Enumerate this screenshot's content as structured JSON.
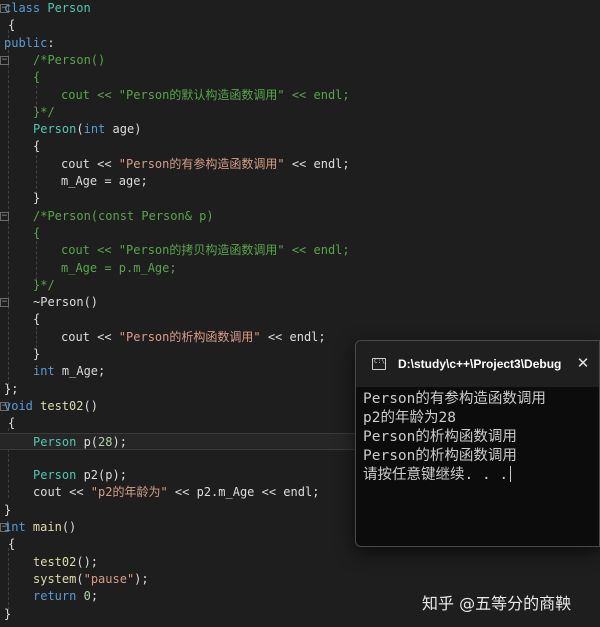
{
  "code": {
    "line1": {
      "k": "class",
      "n": "Person"
    },
    "line2": {
      "b": "{"
    },
    "line3": {
      "k": "public",
      "c": ":"
    },
    "line4": {
      "t": "/*Person()"
    },
    "line5": {
      "t": "{"
    },
    "line6": {
      "t": "cout << \"Person的默认构造函数调用\" << endl;"
    },
    "line7": {
      "t": "}*/"
    },
    "line8": {
      "n": "Person",
      "p1": "(",
      "k": "int",
      "v": " age",
      "p2": ")"
    },
    "line9": {
      "b": "{"
    },
    "line10": {
      "a": "cout << ",
      "s": "\"Person的有参构造函数调用\"",
      "b": " << endl;"
    },
    "line11": {
      "t": "m_Age = age;"
    },
    "line12": {
      "b": "}"
    },
    "line13": {
      "t": "/*Person(const Person& p)"
    },
    "line14": {
      "t": "{"
    },
    "line15": {
      "t": "cout << \"Person的拷贝构造函数调用\" << endl;"
    },
    "line16": {
      "t": "m_Age = p.m_Age;"
    },
    "line17": {
      "t": "}*/"
    },
    "line18": {
      "t": "~Person()"
    },
    "line19": {
      "b": "{"
    },
    "line20": {
      "a": "cout << ",
      "s": "\"Person的析构函数调用\"",
      "b": " << endl;"
    },
    "line21": {
      "b": "}"
    },
    "line22": {
      "k": "int",
      "v": " m_Age;"
    },
    "line23": {
      "b": "};"
    },
    "line24": {
      "k": "void",
      "f": " test02",
      "p": "()"
    },
    "line25": {
      "b": "{"
    },
    "line26": {
      "n": "Person",
      "a": " p(",
      "num": "28",
      "b": ");"
    },
    "line27": {
      "b": ""
    },
    "line28": {
      "n": "Person",
      "a": " p2(p);"
    },
    "line29": {
      "a": "cout << ",
      "s": "\"p2的年龄为\"",
      "b": " << p2.m_Age << endl;"
    },
    "line30": {
      "b": "}"
    },
    "line31": {
      "k": "int",
      "f": " main",
      "p": "()"
    },
    "line32": {
      "b": "{"
    },
    "line33": {
      "f": "test02",
      "a": "();"
    },
    "line34": {
      "f": "system",
      "a": "(",
      "s": "\"pause\"",
      "b": ");"
    },
    "line35": {
      "k": "return",
      "num": " 0",
      "b": ";"
    },
    "line36": {
      "b": "}"
    }
  },
  "console": {
    "title": "D:\\study\\c++\\Project3\\Debug",
    "close_label": "✕",
    "output": [
      "Person的有参构造函数调用",
      "p2的年龄为28",
      "Person的析构函数调用",
      "Person的析构函数调用",
      "请按任意键继续. . ."
    ]
  },
  "watermark": "知乎 @五等分的商鞅",
  "colors": {
    "background": "#1e1e1e",
    "keyword": "#569cd6",
    "type": "#4ec9b0",
    "string": "#d69d85",
    "comment": "#57a64a",
    "number": "#b5cea8"
  }
}
